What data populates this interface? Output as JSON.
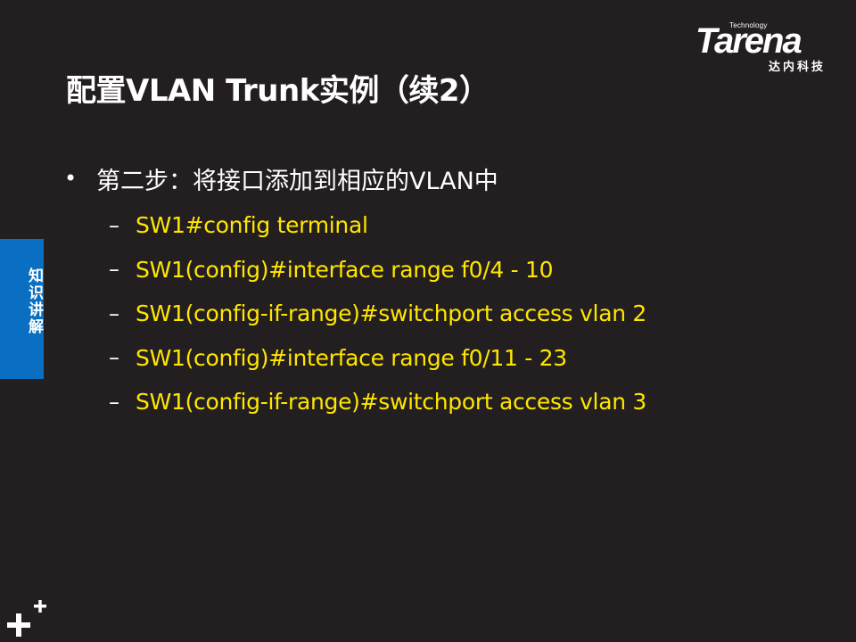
{
  "logo": {
    "technology": "Technology",
    "name": "Tarena",
    "cn_name": "达内科技"
  },
  "title": "配置VLAN Trunk实例（续2）",
  "side_tab": {
    "label": "知识讲解",
    "color": "#0a6fc2"
  },
  "bullet": {
    "symbol": "•",
    "text": "第二步：将接口添加到相应的VLAN中"
  },
  "steps": [
    {
      "dash": "–",
      "text": "SW1#config terminal"
    },
    {
      "dash": "–",
      "text": "SW1(config)#interface range f0/4 - 10"
    },
    {
      "dash": "–",
      "text": "SW1(config-if-range)#switchport access vlan 2"
    },
    {
      "dash": "–",
      "text": "SW1(config)#interface range f0/11 - 23"
    },
    {
      "dash": "–",
      "text": "SW1(config-if-range)#switchport access vlan 3"
    }
  ],
  "colors": {
    "background": "#231f20",
    "command_text": "#ffe600",
    "heading_text": "#ffffff"
  },
  "corner_icon": "plus-plus-icon"
}
